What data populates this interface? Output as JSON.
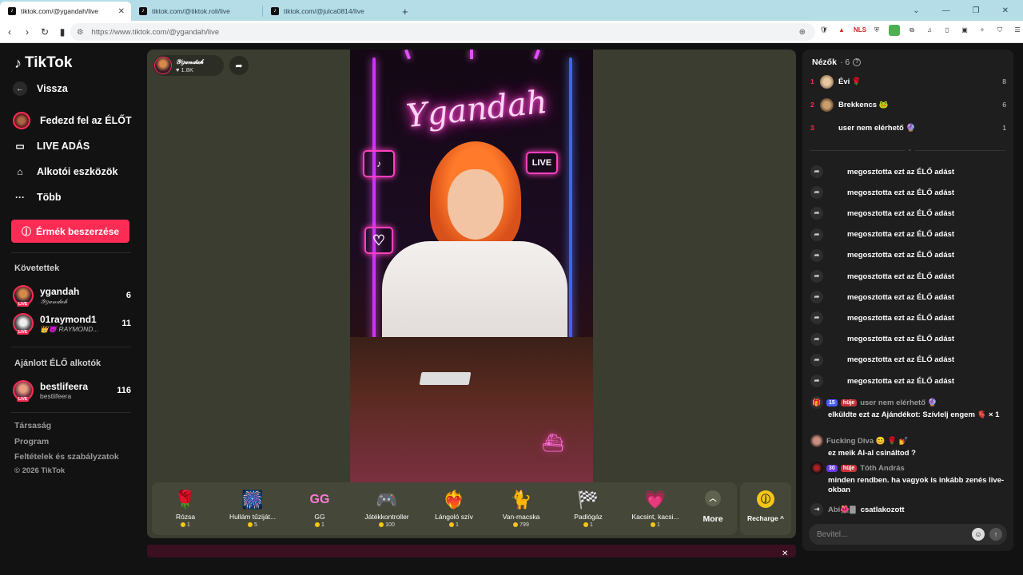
{
  "browser": {
    "tabs": [
      {
        "title": "tiktok.com/@ygandah/live",
        "active": true
      },
      {
        "title": "tiktok.com/@tiktok.roli/live",
        "active": false
      },
      {
        "title": "tiktok.com/@julca0814/live",
        "active": false
      }
    ],
    "url": "https://www.tiktok.com/@ygandah/live",
    "accent": "#b5dde8"
  },
  "sidebar": {
    "logo": "TikTok",
    "back": "Vissza",
    "nav": [
      {
        "label": "Fedezd fel az ÉLŐT",
        "icon": "explore-live-icon"
      },
      {
        "label": "LIVE ADÁS",
        "icon": "camera-icon"
      },
      {
        "label": "Alkotói eszközök",
        "icon": "creator-tools-icon"
      },
      {
        "label": "Több",
        "icon": "more-dots-icon"
      }
    ],
    "coins_button": "Érmék beszerzése",
    "following_title": "Követettek",
    "following": [
      {
        "name": "ygandah",
        "sub": "𝒴𝑔𝒶𝓃𝒹𝒶𝒽",
        "count": "6",
        "live": "LIVE"
      },
      {
        "name": "01raymond1",
        "sub": "👑😈 RAYMOND...",
        "count": "11",
        "live": "LIVE"
      }
    ],
    "recommended_title": "Ajánlott ÉLŐ alkotók",
    "recommended": [
      {
        "name": "bestlifeera",
        "sub": "bestlifeera",
        "count": "116",
        "live": "LIVE"
      }
    ],
    "footer": [
      "Társaság",
      "Program",
      "Feltételek és szabályzatok",
      "© 2026 TikTok"
    ],
    "brand_color": "#fe2c55"
  },
  "stream": {
    "host_name": "𝒴𝑔𝒶𝓃𝒹𝒶𝒽",
    "host_likes": "♥ 1.8K",
    "neon_text": "Ygandah",
    "live_sign": "LIVE"
  },
  "gifts": [
    {
      "name": "Rózsa",
      "price": "1",
      "icon": "🌹"
    },
    {
      "name": "Hullám tűziját...",
      "price": "5",
      "icon": "🎆"
    },
    {
      "name": "GG",
      "price": "1",
      "icon": "GG"
    },
    {
      "name": "Játékkontroller",
      "price": "100",
      "icon": "🎮"
    },
    {
      "name": "Lángoló szív",
      "price": "1",
      "icon": "❤️‍🔥"
    },
    {
      "name": "Van-macska",
      "price": "799",
      "icon": "🐈"
    },
    {
      "name": "Padlógáz",
      "price": "1",
      "icon": "🏁"
    },
    {
      "name": "Kacsint, kacsi...",
      "price": "1",
      "icon": "💗"
    }
  ],
  "more_label": "More",
  "recharge_label": "Recharge ^",
  "panel": {
    "viewers_title": "Nézők",
    "viewers_count": "· 6",
    "viewers": [
      {
        "rank": "1",
        "name": "Évi 🌹",
        "score": "8"
      },
      {
        "rank": "2",
        "name": "Brekkencs 🐸",
        "score": "6"
      },
      {
        "rank": "3",
        "name": "user nem elérhető 🔮",
        "score": "1"
      }
    ],
    "share_text": "megosztotta ezt az ÉLŐ adást",
    "share_count": 11,
    "chats": [
      {
        "badge1": "15",
        "badge2": "hüje",
        "user": "user nem elérhető 🔮",
        "message": "elküldte ezt az Ajándékot: Szívlelj engem 🫀 × 1"
      },
      {
        "badge1": "",
        "badge2": "",
        "user": "Fucking Diva 😊 🌹 💅",
        "message": "ez meik AI-al csináltod ?"
      },
      {
        "badge1": "30",
        "badge2": "hüje",
        "user": "Tóth András",
        "message": "minden rendben. ha vagyok is inkább zenés live-okban"
      }
    ],
    "joined_user": "Abi🌺🀫",
    "joined_text": "csatlakozott",
    "input_placeholder": "Bevitel..."
  }
}
